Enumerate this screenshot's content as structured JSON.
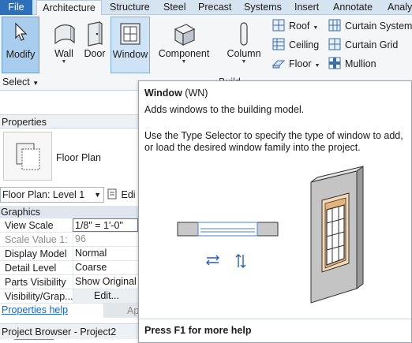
{
  "ribbon_tabs": [
    "File",
    "Architecture",
    "Structure",
    "Steel",
    "Precast",
    "Systems",
    "Insert",
    "Annotate",
    "Analy"
  ],
  "ribbon": {
    "modify": "Modify",
    "wall": "Wall",
    "door": "Door",
    "window": "Window",
    "component": "Component",
    "column": "Column",
    "select_label": "Select",
    "build_label": "Build",
    "roof": "Roof",
    "ceiling": "Ceiling",
    "floor": "Floor",
    "curtain_system": "Curtain System",
    "curtain_grid": "Curtain Grid",
    "mullion": "Mullion"
  },
  "properties": {
    "title": "Properties",
    "type_name": "Floor Plan",
    "selector_value": "Floor Plan: Level 1",
    "edit_type": "Edi",
    "group": "Graphics",
    "rows": [
      {
        "k": "View Scale",
        "v": "1/8\" = 1'-0\""
      },
      {
        "k": "Scale Value  1:",
        "v": "96"
      },
      {
        "k": "Display Model",
        "v": "Normal"
      },
      {
        "k": "Detail Level",
        "v": "Coarse"
      },
      {
        "k": "Parts Visibility",
        "v": "Show Original"
      },
      {
        "k": "Visibility/Grap...",
        "v": "Edit..."
      }
    ],
    "help": "Properties help",
    "apply": "Ap"
  },
  "project_browser": {
    "title": "Project Browser - Project2"
  },
  "tooltip": {
    "title": "Window",
    "shortcut": "(WN)",
    "description": "Adds windows to the building model.",
    "body": "Use the Type Selector to specify the type of window to add, or load the desired window family into the project.",
    "footer": "Press F1 for more help"
  },
  "colors": {
    "file_tab": "#2d6fb9",
    "tab_bar": "#d6e4f2",
    "active_button": "#a9cdef",
    "link": "#1a64c8",
    "wall_gray": "#c8c8c8",
    "window_frame": "#e4b47c"
  }
}
